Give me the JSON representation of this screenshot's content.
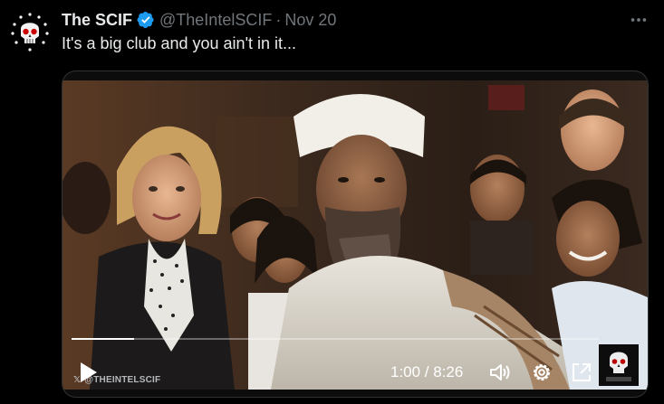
{
  "tweet": {
    "author_name": "The SCIF",
    "handle": "@TheIntelSCIF",
    "separator": "·",
    "date": "Nov 20",
    "text": "It's a big club and you ain't in it...",
    "verified_color": "#1d9bf0",
    "avatar_icon": "skull-stars-logo-icon",
    "more_icon": "more-dots-icon"
  },
  "video": {
    "watermark_prefix": "𝕏",
    "watermark": "@THEINTELSCIF",
    "timecode": "1:00 / 8:26",
    "progress": 0.118,
    "corner_logo_icon": "skull-logo-icon",
    "controls": {
      "play_icon": "play-icon",
      "volume_icon": "volume-icon",
      "settings_icon": "settings-gear-icon",
      "popout_icon": "popout-icon",
      "fullscreen_icon": "fullscreen-icon"
    }
  }
}
